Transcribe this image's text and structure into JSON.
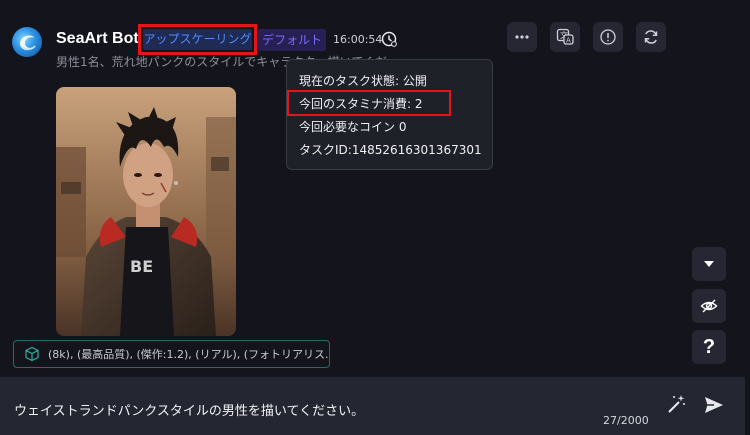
{
  "header": {
    "bot_name": "SeaArt Bot",
    "tag_upscale": "アップスケーリング",
    "tag_default": "デフォルト",
    "time": "16:00:54",
    "prompt_preview": "男性1名、荒れ地パンクのスタイルでキャラクター描いてくだ"
  },
  "toolbar": {
    "icons": [
      "more-icon",
      "translate-icon",
      "report-icon",
      "refresh-icon"
    ]
  },
  "tooltip": {
    "status": "現在のタスク状態: 公開",
    "stamina": "今回のスタミナ消費:  2",
    "coins": "今回必要なコイン 0",
    "task_id": "タスクID:14852616301367301"
  },
  "prompt_chip": {
    "text": "(8k), (最高品質), (傑作:1.2), (リアル), (フォトリアリス..."
  },
  "side_buttons": {
    "help": "?"
  },
  "input": {
    "value": "ウェイストランドパンクスタイルの男性を描いてください。",
    "counter": "27/2000"
  },
  "colors": {
    "background": "#14141c",
    "highlight_border": "#e3141b",
    "tag_upscale_text": "#4d8dff",
    "tag_default_text": "#7b6cff",
    "chip_border": "#1f6f66"
  }
}
